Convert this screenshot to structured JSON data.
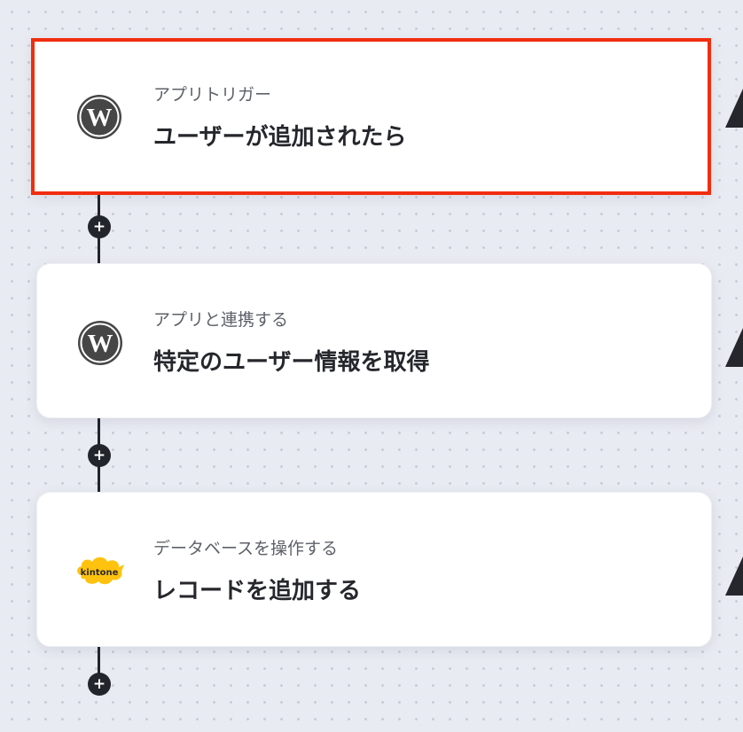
{
  "flow": {
    "steps": [
      {
        "app_icon": "wordpress-icon",
        "subtitle": "アプリトリガー",
        "title": "ユーザーが追加されたら",
        "selected": true,
        "highlight_color": "#f12d0f"
      },
      {
        "app_icon": "wordpress-icon",
        "subtitle": "アプリと連携する",
        "title": "特定のユーザー情報を取得",
        "selected": false
      },
      {
        "app_icon": "kintone-icon",
        "icon_text": "kintone",
        "subtitle": "データベースを操作する",
        "title": "レコードを追加する",
        "selected": false
      }
    ],
    "add_step_icon": "+",
    "colors": {
      "kintone_yellow": "#ffc20e",
      "wordpress_gray": "#464646",
      "connector": "#22252b"
    }
  }
}
